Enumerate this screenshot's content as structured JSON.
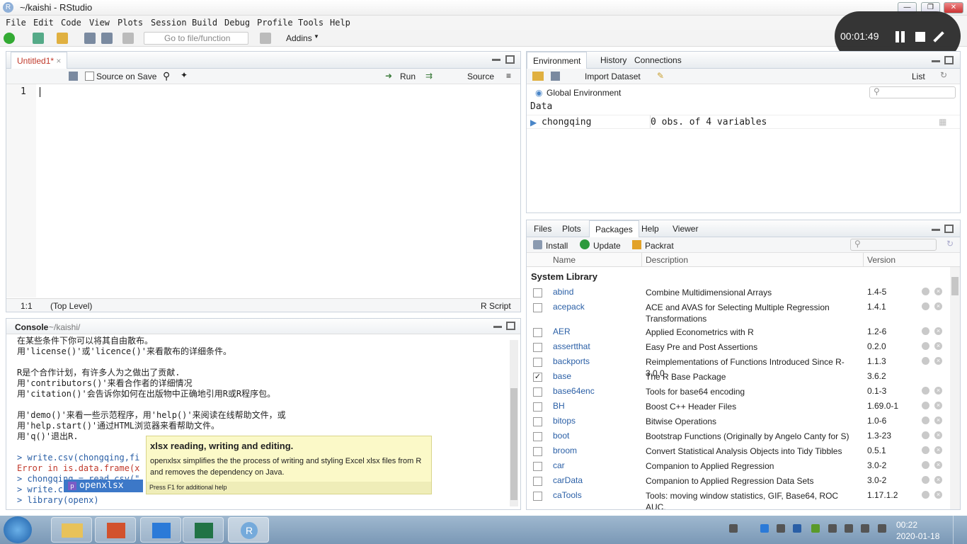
{
  "window": {
    "title": "~/kaishi - RStudio",
    "min": "—",
    "max": "❐",
    "close": "✕"
  },
  "menu": [
    "File",
    "Edit",
    "Code",
    "View",
    "Plots",
    "Session",
    "Build",
    "Debug",
    "Profile",
    "Tools",
    "Help"
  ],
  "toolbar": {
    "goto_placeholder": "Go to file/function",
    "addins": "Addins"
  },
  "recorder": {
    "time": "00:01:49"
  },
  "editor": {
    "tab": "Untitled1*",
    "source_on_save": "Source on Save",
    "run": "Run",
    "source": "Source",
    "line_number": "1",
    "position": "1:1",
    "scope": "(Top Level)",
    "filetype": "R Script"
  },
  "console": {
    "title": "Console",
    "path": "~/kaishi/",
    "lines": [
      "在某些条件下你可以将其自由散布。",
      "用'license()'或'licence()'来看散布的详细条件。",
      "",
      "R是个合作计划，有许多人为之做出了贡献.",
      "用'contributors()'来看合作者的详细情况",
      "用'citation()'会告诉你如何在出版物中正确地引用R或R程序包。",
      "",
      "用'demo()'来看一些示范程序，用'help()'来阅读在线帮助文件，或",
      "用'help.start()'通过HTML浏览器来看帮助文件。",
      "用'q()'退出R.",
      ""
    ],
    "cmd1": "> write.csv(chongqing,fi",
    "err1": "Error in is.data.frame(x",
    "cmd2": "> chongqing = read.csv(\"",
    "cmd3": "> write.c",
    "cmd4": "> library(openx)"
  },
  "autocomplete": {
    "item": "openxlsx",
    "badge": "p"
  },
  "tooltip": {
    "title": "xlsx reading, writing and editing.",
    "body": "openxlsx simplifies the the process of writing and styling Excel xlsx files from R and removes the dependency on Java.",
    "hint": "Press F1 for additional help"
  },
  "environment": {
    "tabs": [
      "Environment",
      "History",
      "Connections"
    ],
    "import": "Import Dataset",
    "list": "List",
    "scope": "Global Environment",
    "section": "Data",
    "rows": [
      {
        "name": "chongqing",
        "value": "0 obs. of 4 variables"
      }
    ]
  },
  "files": {
    "tabs": [
      "Files",
      "Plots",
      "Packages",
      "Help",
      "Viewer"
    ],
    "install": "Install",
    "update": "Update",
    "packrat": "Packrat",
    "headers": [
      "Name",
      "Description",
      "Version"
    ],
    "section": "System Library",
    "packages": [
      {
        "name": "abind",
        "desc": "Combine Multidimensional Arrays",
        "ver": "1.4-5",
        "checked": false
      },
      {
        "name": "acepack",
        "desc": "ACE and AVAS for Selecting Multiple Regression Transformations",
        "ver": "1.4.1",
        "checked": false
      },
      {
        "name": "AER",
        "desc": "Applied Econometrics with R",
        "ver": "1.2-6",
        "checked": false
      },
      {
        "name": "assertthat",
        "desc": "Easy Pre and Post Assertions",
        "ver": "0.2.0",
        "checked": false
      },
      {
        "name": "backports",
        "desc": "Reimplementations of Functions Introduced Since R-3.0.0",
        "ver": "1.1.3",
        "checked": false
      },
      {
        "name": "base",
        "desc": "The R Base Package",
        "ver": "3.6.2",
        "checked": true
      },
      {
        "name": "base64enc",
        "desc": "Tools for base64 encoding",
        "ver": "0.1-3",
        "checked": false
      },
      {
        "name": "BH",
        "desc": "Boost C++ Header Files",
        "ver": "1.69.0-1",
        "checked": false
      },
      {
        "name": "bitops",
        "desc": "Bitwise Operations",
        "ver": "1.0-6",
        "checked": false
      },
      {
        "name": "boot",
        "desc": "Bootstrap Functions (Originally by Angelo Canty for S)",
        "ver": "1.3-23",
        "checked": false
      },
      {
        "name": "broom",
        "desc": "Convert Statistical Analysis Objects into Tidy Tibbles",
        "ver": "0.5.1",
        "checked": false
      },
      {
        "name": "car",
        "desc": "Companion to Applied Regression",
        "ver": "3.0-2",
        "checked": false
      },
      {
        "name": "carData",
        "desc": "Companion to Applied Regression Data Sets",
        "ver": "3.0-2",
        "checked": false
      },
      {
        "name": "caTools",
        "desc": "Tools: moving window statistics, GIF, Base64, ROC AUC,",
        "ver": "1.17.1.2",
        "checked": false
      }
    ]
  },
  "taskbar": {
    "time": "00:22",
    "date": "2020-01-18",
    "r_label": "R"
  }
}
